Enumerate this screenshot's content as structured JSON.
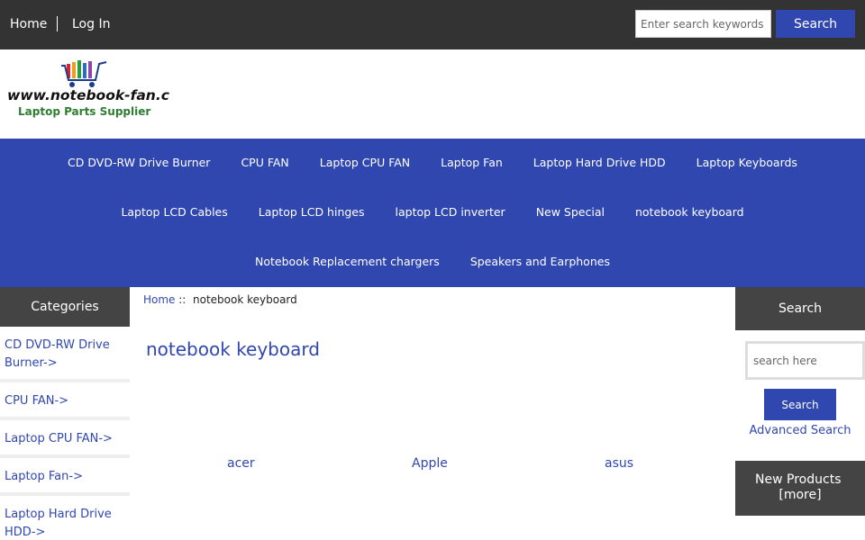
{
  "topbar": {
    "home": "Home",
    "login": "Log In",
    "search_placeholder": "Enter search keywords",
    "search_button": "Search"
  },
  "header": {
    "logo_text": "www.notebook-fan.com",
    "logo_tagline": "Laptop Parts Supplier"
  },
  "category_nav": {
    "row1": [
      "CD DVD-RW Drive Burner",
      "CPU FAN",
      "Laptop CPU FAN",
      "Laptop Fan",
      "Laptop Hard Drive HDD",
      "Laptop Keyboards"
    ],
    "row2": [
      "Laptop LCD Cables",
      "Laptop LCD hinges",
      "laptop LCD inverter",
      "New Special",
      "notebook keyboard"
    ],
    "row3": [
      "Notebook Replacement chargers",
      "Speakers and Earphones"
    ]
  },
  "sidebar": {
    "title": "Categories",
    "items": [
      "CD DVD-RW Drive Burner->",
      "CPU FAN->",
      "Laptop CPU FAN->",
      "Laptop Fan->",
      "Laptop Hard Drive HDD->"
    ]
  },
  "breadcrumb": {
    "home": "Home",
    "separator": "::",
    "current": "notebook keyboard"
  },
  "main": {
    "heading": "notebook keyboard",
    "subcategories": [
      "acer",
      "Apple",
      "asus"
    ]
  },
  "right_sidebar": {
    "search_title": "Search",
    "search_placeholder": "search here",
    "search_button": "Search",
    "advanced_search": "Advanced Search",
    "new_products_label": "New Products",
    "more_link": "[more]"
  },
  "colors": {
    "brand_blue": "#3047b0",
    "dark_bar": "#333333",
    "sidebar_header": "#444444"
  }
}
